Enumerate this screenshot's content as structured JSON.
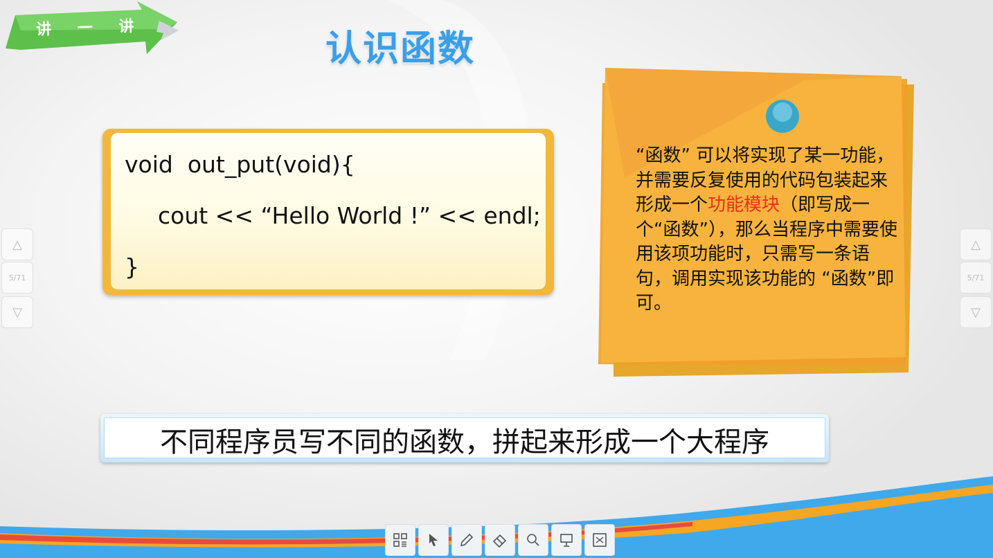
{
  "banner": {
    "text": [
      "讲",
      "一",
      "讲"
    ]
  },
  "title": "认识函数",
  "code": {
    "line1": "void  out_put(void){",
    "line2": "cout << “Hello World !” << endl;",
    "line3": "}"
  },
  "note": {
    "part1": "“函数” 可以将实现了某一功能，并需要反复使用的代码包装起来形成一个",
    "highlight": "功能模块",
    "part2": "（即写成一个“函数”），那么当程序中需要使用该项功能时，只需写一条语句，调用实现该功能的 “函数”即可。"
  },
  "bottom_banner": "不同程序员写不同的函数，拼起来形成一个大程序",
  "pager": {
    "label": "5/71"
  },
  "colors": {
    "title": "#3b9ee8",
    "code_border": "#f3b73a",
    "note": "#f7b33d",
    "highlight": "#e8301e",
    "banner_green": "#6ccf5a"
  },
  "toolbar": {
    "icons": [
      "grid-icon",
      "pointer-icon",
      "pen-icon",
      "eraser-icon",
      "search-icon",
      "board-icon",
      "presentation-icon"
    ]
  }
}
